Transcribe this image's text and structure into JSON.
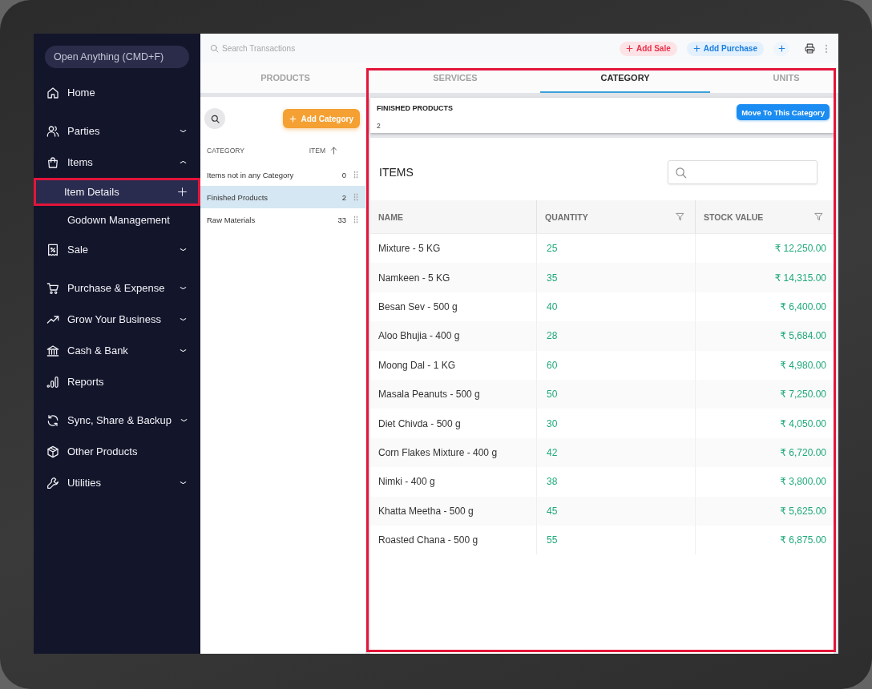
{
  "sidebar": {
    "search": {
      "placeholder": "Open Anything (CMD+F)"
    },
    "sections": [
      {
        "items": [
          {
            "label": "Home",
            "kind": "link"
          }
        ]
      },
      {
        "items": [
          {
            "label": "Parties",
            "kind": "group",
            "expanded": false
          },
          {
            "label": "Items",
            "kind": "group",
            "expanded": true,
            "children": [
              {
                "label": "Item Details",
                "selected": true,
                "add_button": true,
                "highlighted": true
              },
              {
                "label": "Godown Management",
                "selected": false,
                "add_button": false,
                "highlighted": false
              }
            ]
          },
          {
            "label": "Sale",
            "kind": "group",
            "expanded": false
          }
        ]
      },
      {
        "items": [
          {
            "label": "Purchase & Expense",
            "kind": "group",
            "expanded": false
          },
          {
            "label": "Grow Your Business",
            "kind": "group",
            "expanded": false
          },
          {
            "label": "Cash & Bank",
            "kind": "group",
            "expanded": false
          },
          {
            "label": "Reports",
            "kind": "link"
          }
        ]
      },
      {
        "items": [
          {
            "label": "Sync, Share & Backup",
            "kind": "group",
            "expanded": false
          },
          {
            "label": "Other Products",
            "kind": "link"
          },
          {
            "label": "Utilities",
            "kind": "group",
            "expanded": false
          }
        ]
      }
    ]
  },
  "top_bar": {
    "search": {
      "placeholder": "Search Transactions"
    },
    "actions": [
      {
        "kind": "sale",
        "label": "Add Sale"
      },
      {
        "kind": "purchase",
        "label": "Add Purchase"
      },
      {
        "kind": "add"
      }
    ]
  },
  "tabs": [
    {
      "label": "PRODUCTS",
      "selected": false
    },
    {
      "label": "SERVICES",
      "selected": false
    },
    {
      "label": "CATEGORY",
      "selected": true
    },
    {
      "label": "UNITS",
      "selected": false
    }
  ],
  "category_panel": {
    "add_button": "Add Category",
    "columns": [
      "CATEGORY",
      "ITEM"
    ],
    "sort_ascending": true,
    "rows": [
      {
        "name": "Items not in any Category",
        "count": "0",
        "selected": false
      },
      {
        "name": "Finished Products",
        "count": "2",
        "selected": true
      },
      {
        "name": "Raw Materials",
        "count": "33",
        "selected": false
      }
    ]
  },
  "detail": {
    "highlighted": true,
    "category_card": {
      "title": "FINISHED PRODUCTS",
      "count": "2",
      "button": "Move To This Category"
    },
    "items": {
      "title": "ITEMS",
      "columns": [
        {
          "label": "NAME",
          "filter": false
        },
        {
          "label": "QUANTITY",
          "filter": true
        },
        {
          "label": "STOCK VALUE",
          "filter": true
        }
      ],
      "rows": [
        {
          "name": "Mixture - 5 KG",
          "quantity": "25",
          "stock_value": "₹ 12,250.00"
        },
        {
          "name": "Namkeen - 5 KG",
          "quantity": "35",
          "stock_value": "₹ 14,315.00"
        },
        {
          "name": "Besan Sev - 500 g",
          "quantity": "40",
          "stock_value": "₹ 6,400.00"
        },
        {
          "name": "Aloo Bhujia - 400 g",
          "quantity": "28",
          "stock_value": "₹ 5,684.00"
        },
        {
          "name": "Moong Dal - 1 KG",
          "quantity": "60",
          "stock_value": "₹ 4,980.00"
        },
        {
          "name": "Masala Peanuts - 500 g",
          "quantity": "50",
          "stock_value": "₹ 7,250.00"
        },
        {
          "name": "Diet Chivda - 500 g",
          "quantity": "30",
          "stock_value": "₹ 4,050.00"
        },
        {
          "name": "Corn Flakes Mixture - 400 g",
          "quantity": "42",
          "stock_value": "₹ 6,720.00"
        },
        {
          "name": "Nimki - 400 g",
          "quantity": "38",
          "stock_value": "₹ 3,800.00"
        },
        {
          "name": "Khatta Meetha - 500 g",
          "quantity": "45",
          "stock_value": "₹ 5,625.00"
        },
        {
          "name": "Roasted Chana - 500 g",
          "quantity": "55",
          "stock_value": "₹ 6,875.00"
        }
      ]
    }
  }
}
